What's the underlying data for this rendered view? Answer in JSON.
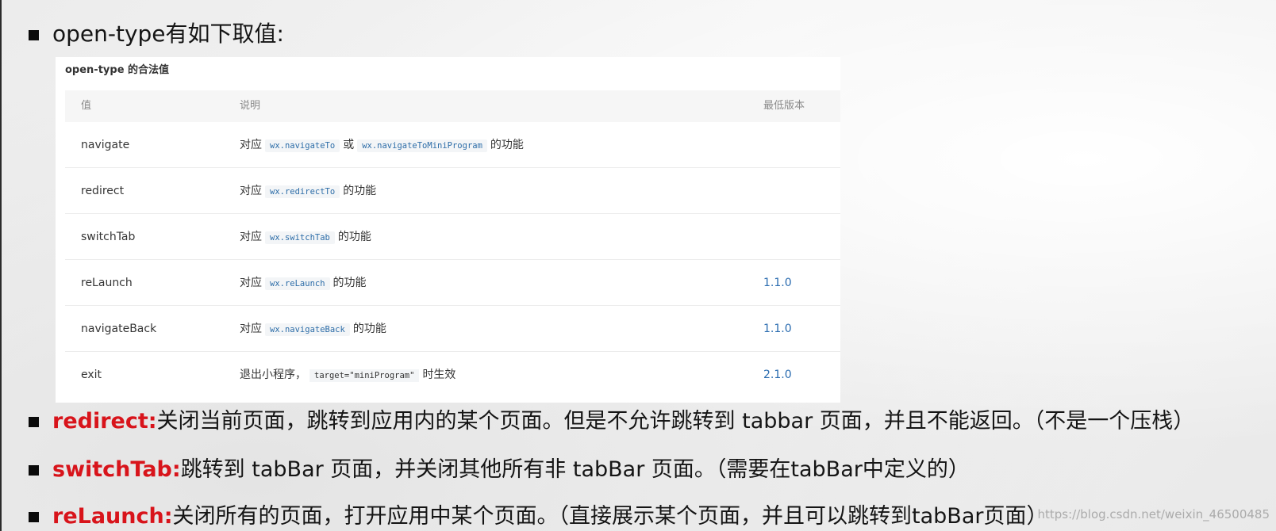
{
  "heading": "open-type有如下取值:",
  "card": {
    "title": "open-type 的合法值",
    "headers": [
      "值",
      "说明",
      "最低版本"
    ],
    "rows": [
      {
        "value": "navigate",
        "pre": "对应",
        "code1": "wx.navigateTo",
        "mid": "或",
        "code2": "wx.navigateToMiniProgram",
        "post": "的功能",
        "version": ""
      },
      {
        "value": "redirect",
        "pre": "对应",
        "code1": "wx.redirectTo",
        "post": "的功能",
        "version": ""
      },
      {
        "value": "switchTab",
        "pre": "对应",
        "code1": "wx.switchTab",
        "post": "的功能",
        "version": ""
      },
      {
        "value": "reLaunch",
        "pre": "对应",
        "code1": "wx.reLaunch",
        "post": "的功能",
        "version": "1.1.0"
      },
      {
        "value": "navigateBack",
        "pre": "对应",
        "code1": "wx.navigateBack",
        "post": "的功能",
        "version": "1.1.0"
      },
      {
        "value": "exit",
        "pre": "退出小程序，",
        "code1": "target=\"miniProgram\"",
        "post": "时生效",
        "version": "2.1.0"
      }
    ]
  },
  "notes": [
    {
      "keyword": "redirect:",
      "text": "关闭当前页面，跳转到应用内的某个页面。但是不允许跳转到 tabbar 页面，并且不能返回。（不是一个压栈）"
    },
    {
      "keyword": "switchTab:",
      "text": "跳转到 tabBar 页面，并关闭其他所有非 tabBar 页面。（需要在tabBar中定义的）"
    },
    {
      "keyword": "reLaunch:",
      "text": "关闭所有的页面，打开应用中某个页面。（直接展示某个页面，并且可以跳转到tabBar页面）"
    }
  ],
  "watermark": "https://blog.csdn.net/weixin_46500485",
  "colors": {
    "keyword": "#d8141b",
    "version": "#2b6cb0",
    "code": "#2d6da8"
  }
}
